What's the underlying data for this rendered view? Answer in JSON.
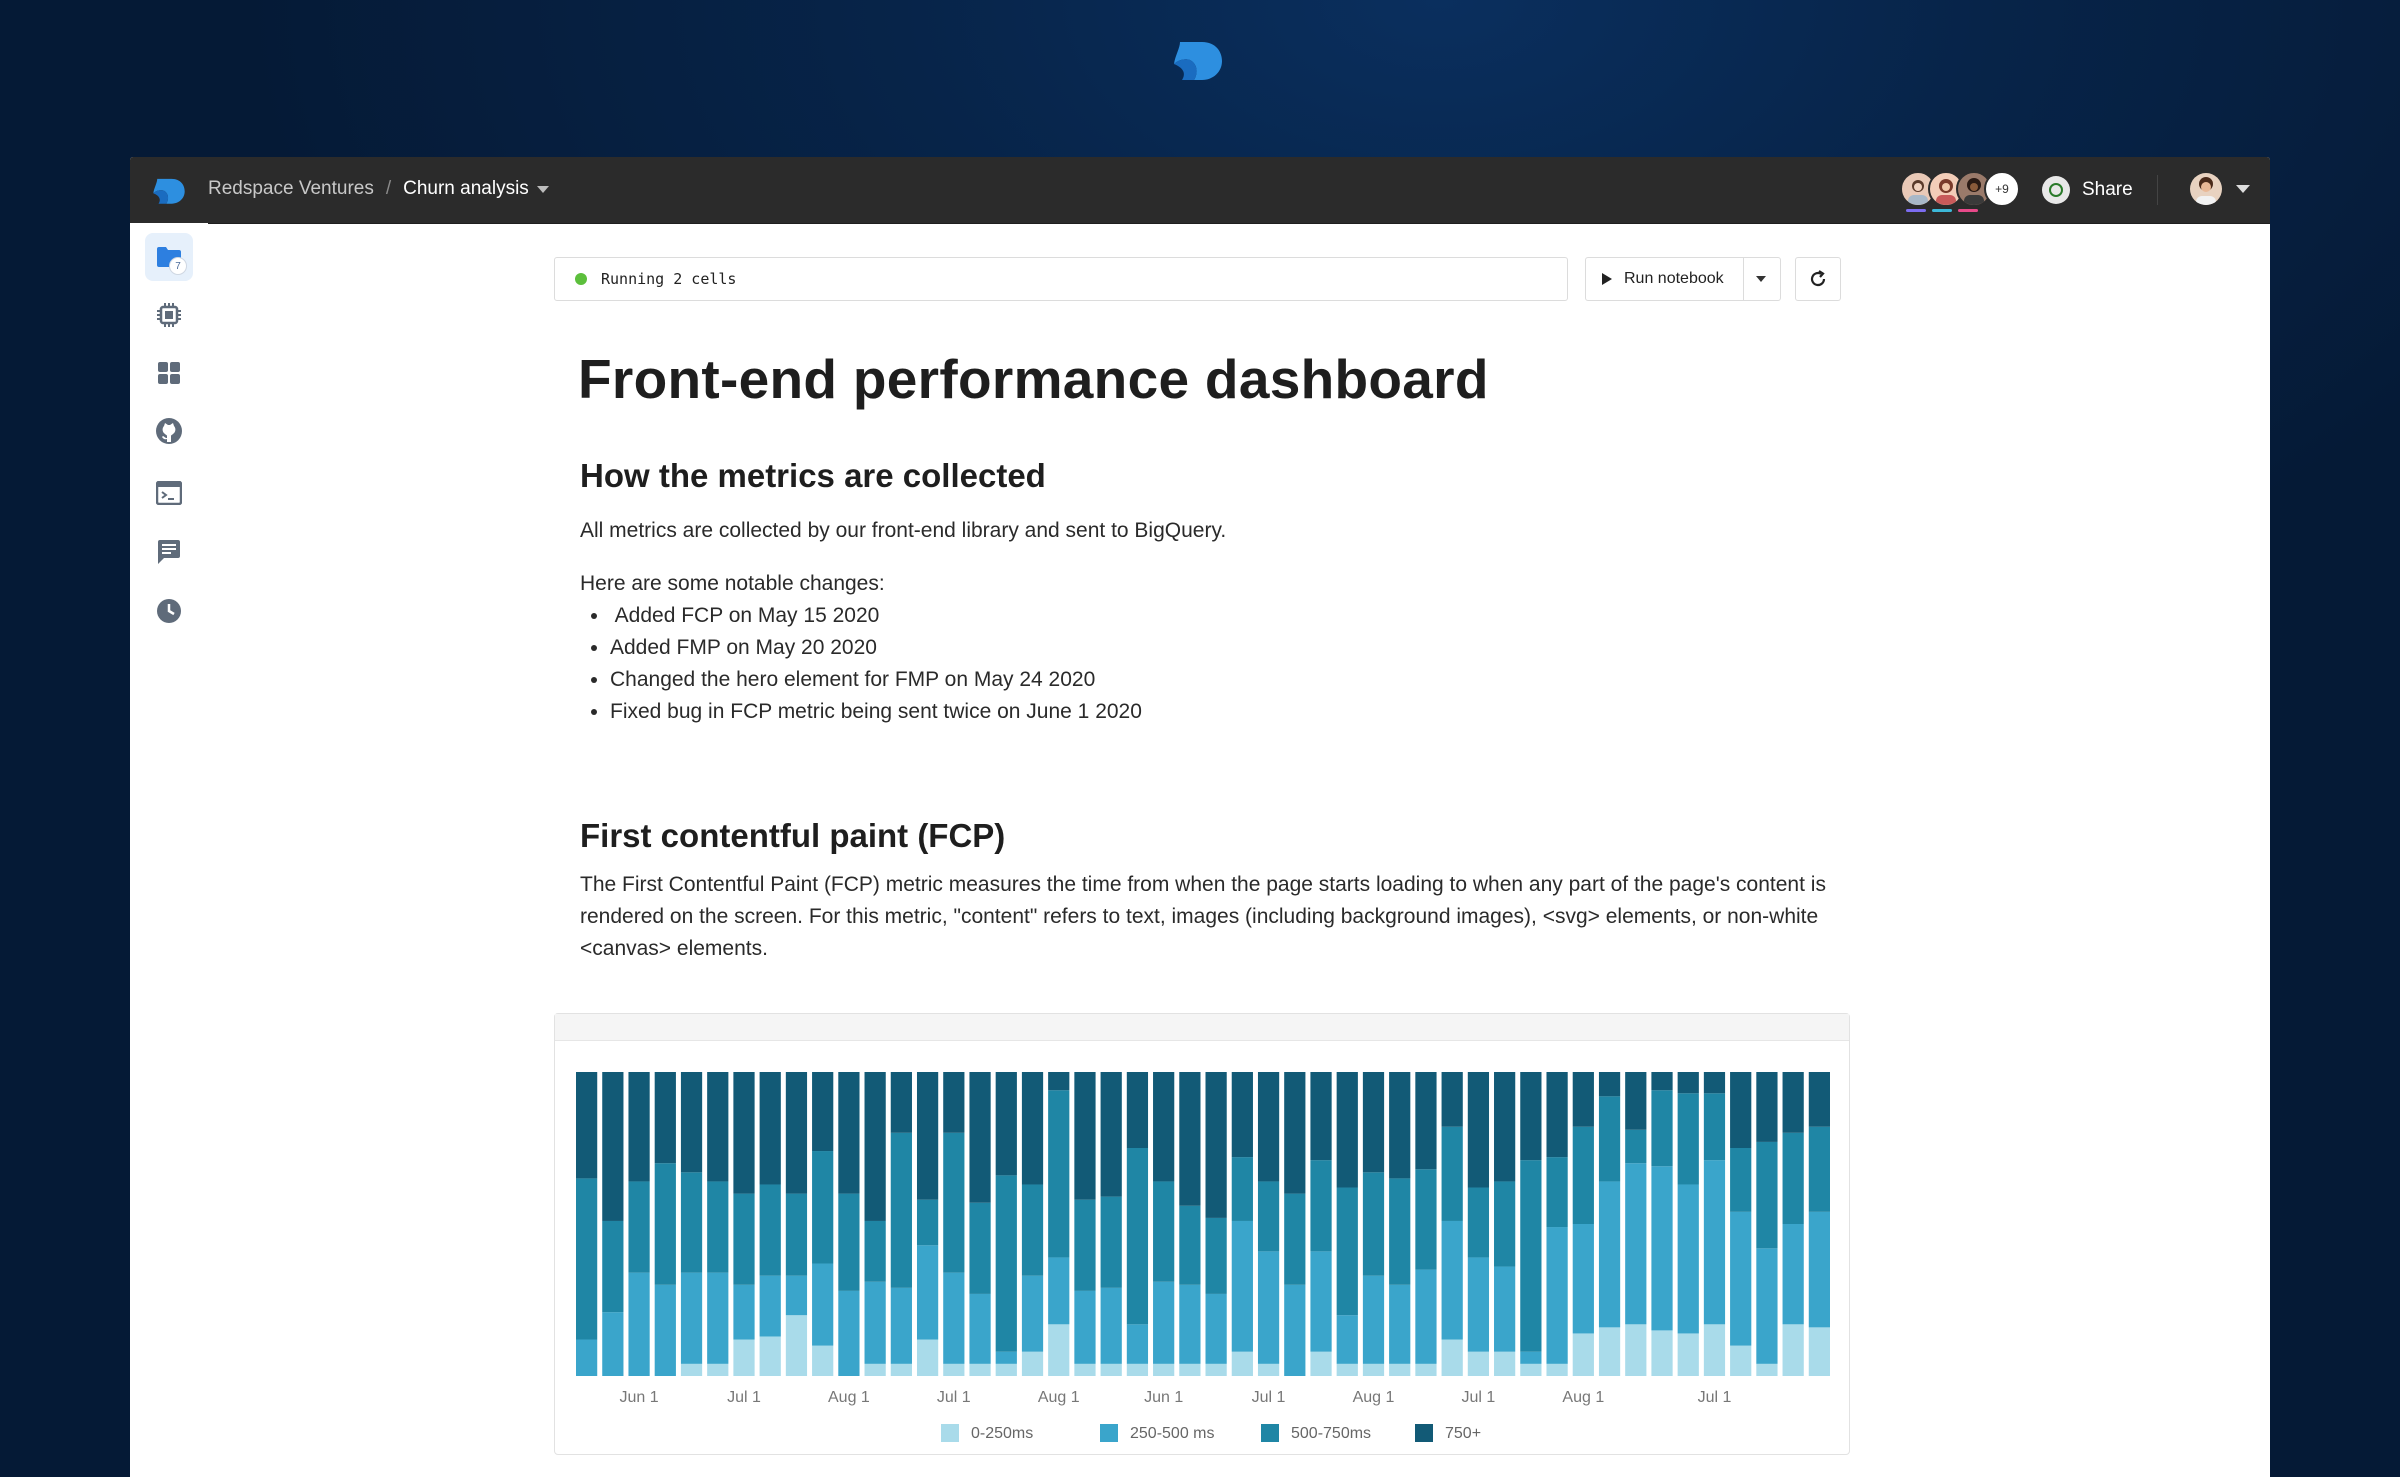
{
  "breadcrumb": {
    "workspace": "Redspace Ventures",
    "separator": "/",
    "notebook": "Churn analysis"
  },
  "collaborators": {
    "extra_count": "+9",
    "underline_colors": [
      "#7c6cf0",
      "#3cb8d8",
      "#e84a8a"
    ]
  },
  "toolbar": {
    "share_label": "Share"
  },
  "sidebar": {
    "items": [
      {
        "icon": "folder-icon",
        "badge": "7",
        "active": true
      },
      {
        "icon": "chip-icon"
      },
      {
        "icon": "grid-icon"
      },
      {
        "icon": "github-icon"
      },
      {
        "icon": "terminal-icon"
      },
      {
        "icon": "comments-icon"
      },
      {
        "icon": "history-icon"
      }
    ]
  },
  "status": {
    "text": "Running 2 cells",
    "color": "#5cbf3c"
  },
  "run": {
    "label": "Run notebook"
  },
  "doc": {
    "title": "Front-end performance dashboard",
    "section1": {
      "heading": "How the metrics are collected",
      "intro": "All metrics are collected by our front-end library and sent to BigQuery.",
      "changes_lead": "Here are some notable changes:",
      "changes": [
        " Added FCP on May 15 2020",
        "Added FMP on May 20 2020",
        "Changed the hero element for FMP on May 24 2020",
        "Fixed bug in FCP metric being sent twice on June 1 2020"
      ]
    },
    "section2": {
      "heading": "First contentful paint (FCP)",
      "body": "The First Contentful Paint (FCP) metric measures the time from when the page starts loading to when any part of the page's content is rendered on the screen. For this metric, \"content\" refers to text, images (including background images), <svg> elements, or non-white <canvas> elements."
    }
  },
  "chart_data": {
    "type": "bar",
    "stacked": true,
    "normalized": true,
    "ylim": [
      0,
      100
    ],
    "x_tick_labels": [
      "Jun 1",
      "Jul 1",
      "Aug 1",
      "Jul 1",
      "Aug 1",
      "Jun 1",
      "Jul 1",
      "Aug 1",
      "Jul 1",
      "Aug 1",
      "Jul 1"
    ],
    "x_tick_bar_index": [
      2,
      6,
      10,
      14,
      18,
      22,
      26,
      30,
      34,
      38,
      43
    ],
    "series": [
      {
        "name": "0-250ms",
        "color": "#a9dbea",
        "values": [
          0,
          0,
          0,
          0,
          4,
          4,
          12,
          13,
          20,
          10,
          0,
          4,
          4,
          12,
          4,
          4,
          4,
          8,
          17,
          4,
          4,
          4,
          4,
          4,
          4,
          8,
          4,
          0,
          8,
          4,
          4,
          4,
          4,
          12,
          8,
          8,
          4,
          4,
          14,
          16,
          17,
          15,
          14,
          17,
          10,
          4,
          17,
          16
        ]
      },
      {
        "name": "250-500 ms",
        "color": "#3aa5cb",
        "values": [
          12,
          21,
          34,
          30,
          30,
          30,
          18,
          20,
          13,
          27,
          28,
          27,
          25,
          31,
          30,
          23,
          4,
          25,
          22,
          24,
          25,
          13,
          27,
          26,
          23,
          43,
          37,
          30,
          33,
          16,
          29,
          26,
          31,
          39,
          31,
          28,
          4,
          45,
          36,
          48,
          53,
          54,
          49,
          54,
          44,
          38,
          33,
          38
        ]
      },
      {
        "name": "500-750ms",
        "color": "#1f86a5",
        "values": [
          53,
          30,
          30,
          40,
          33,
          30,
          30,
          30,
          27,
          37,
          32,
          20,
          51,
          15,
          46,
          30,
          58,
          30,
          55,
          30,
          30,
          58,
          33,
          26,
          25,
          21,
          23,
          30,
          30,
          42,
          34,
          35,
          33,
          31,
          23,
          28,
          63,
          23,
          32,
          28,
          11,
          25,
          30,
          22,
          21,
          35,
          30,
          28
        ]
      },
      {
        "name": "750+",
        "color": "#125a76",
        "values": [
          35,
          49,
          36,
          30,
          33,
          36,
          40,
          37,
          40,
          26,
          40,
          49,
          20,
          42,
          20,
          43,
          34,
          37,
          6,
          42,
          41,
          25,
          36,
          44,
          48,
          28,
          36,
          40,
          29,
          38,
          33,
          35,
          32,
          18,
          38,
          36,
          29,
          28,
          18,
          8,
          19,
          6,
          7,
          7,
          25,
          23,
          20,
          18
        ]
      }
    ]
  }
}
